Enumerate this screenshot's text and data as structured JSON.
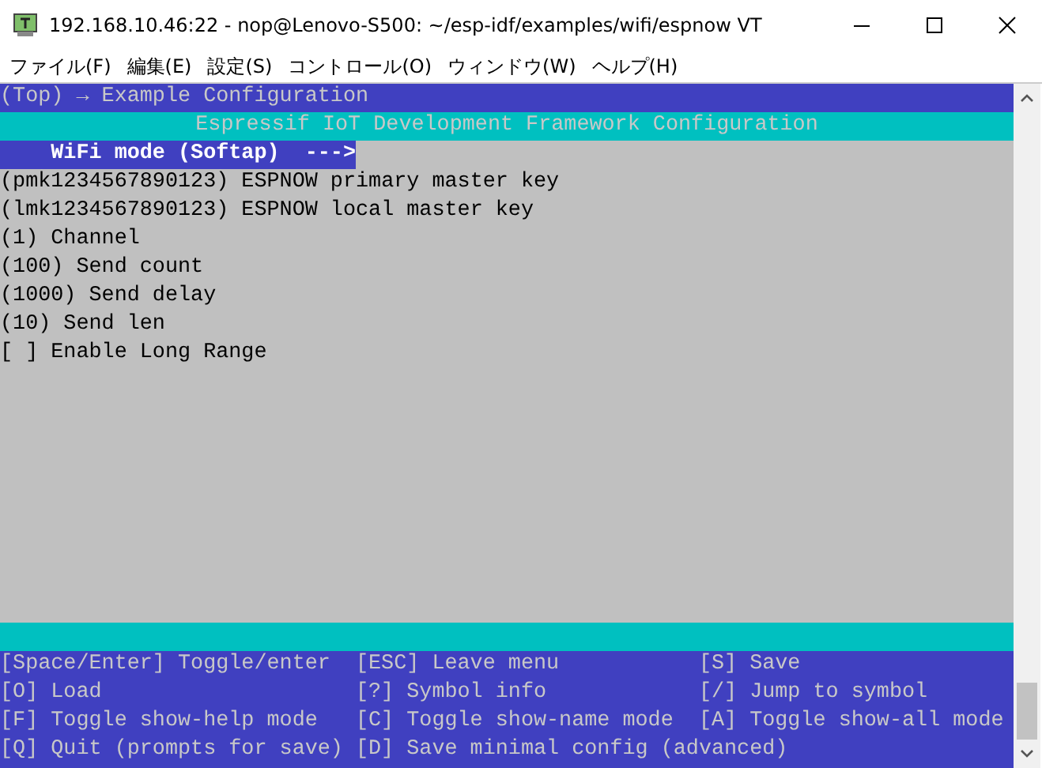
{
  "window": {
    "title": "192.168.10.46:22 - nop@Lenovo-S500: ~/esp-idf/examples/wifi/espnow VT"
  },
  "menu": [
    "ファイル(F)",
    "編集(E)",
    "設定(S)",
    "コントロール(O)",
    "ウィンドウ(W)",
    "ヘルプ(H)"
  ],
  "terminal": {
    "breadcrumb": "(Top) → Example Configuration",
    "header": "Espressif IoT Development Framework Configuration",
    "items": [
      {
        "text": "WiFi mode (Softap)  --->",
        "selected": true
      },
      {
        "text": "(pmk1234567890123) ESPNOW primary master key",
        "selected": false
      },
      {
        "text": "(lmk1234567890123) ESPNOW local master key",
        "selected": false
      },
      {
        "text": "(1) Channel",
        "selected": false
      },
      {
        "text": "(100) Send count",
        "selected": false
      },
      {
        "text": "(1000) Send delay",
        "selected": false
      },
      {
        "text": "(10) Send len",
        "selected": false
      },
      {
        "text": "[ ] Enable Long Range",
        "selected": false
      }
    ],
    "help": [
      [
        "[Space/Enter] Toggle/enter",
        "[ESC] Leave menu",
        "[S] Save"
      ],
      [
        "[O] Load",
        "[?] Symbol info",
        "[/] Jump to symbol"
      ],
      [
        "[F] Toggle show-help mode",
        "[C] Toggle show-name mode",
        "[A] Toggle show-all mode"
      ],
      [
        "[Q] Quit (prompts for save)",
        "[D] Save minimal config (advanced)"
      ]
    ]
  }
}
